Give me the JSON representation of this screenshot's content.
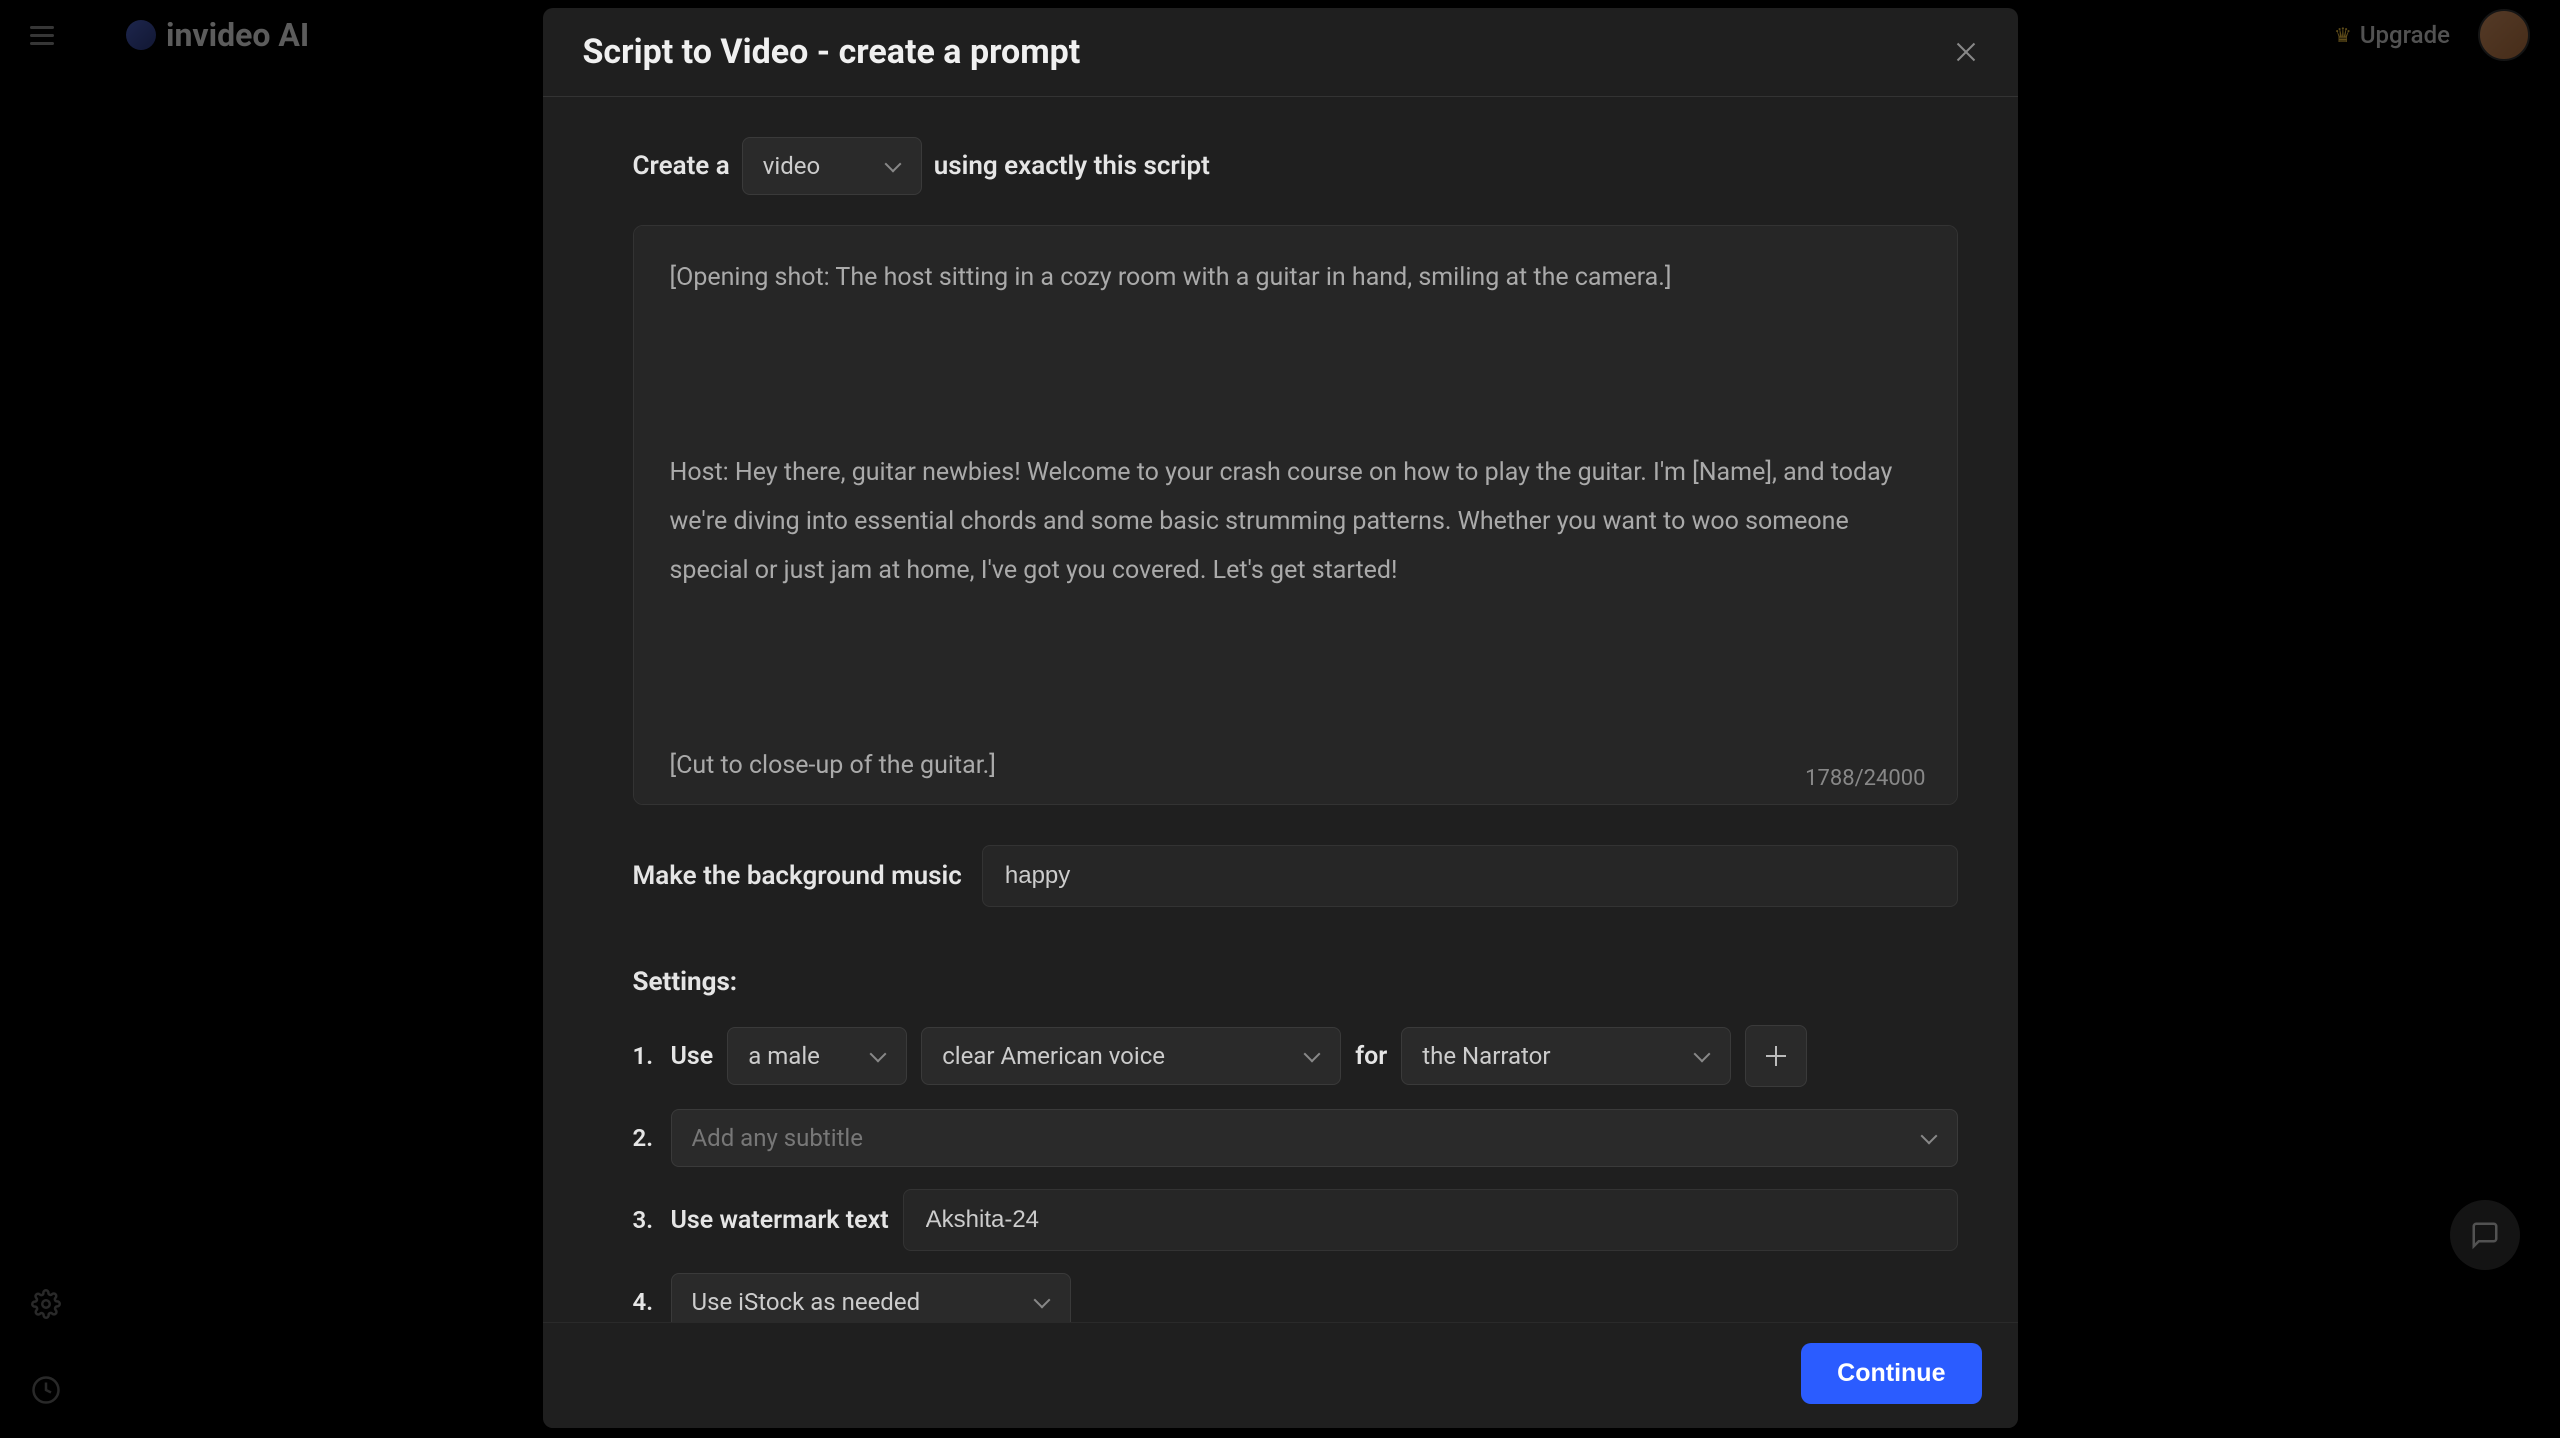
{
  "app": {
    "logo_text": "invideo AI"
  },
  "topbar": {
    "upgrade_label": "Upgrade"
  },
  "modal": {
    "title": "Script to Video - create a prompt",
    "create_a_label": "Create a",
    "video_type": {
      "selected": "video"
    },
    "using_exactly_label": "using exactly this script",
    "script_text": "[Opening shot: The host sitting in a cozy room with a guitar in hand, smiling at the camera.]\n\n\n\nHost: Hey there, guitar newbies! Welcome to your crash course on how to play the guitar. I'm [Name], and today we're diving into essential chords and some basic strumming patterns. Whether you want to woo someone special or just jam at home, I've got you covered. Let's get started!\n\n\n\n[Cut to close-up of the guitar.]",
    "char_count": "1788/24000",
    "music_label": "Make the background music",
    "music_value": "happy",
    "settings_heading": "Settings:",
    "settings": {
      "row1": {
        "number": "1.",
        "use_label": "Use",
        "voice_gender": "a male",
        "voice_accent": "clear American voice",
        "for_label": "for",
        "narrator": "the Narrator"
      },
      "row2": {
        "number": "2.",
        "subtitle_placeholder": "Add any subtitle"
      },
      "row3": {
        "number": "3.",
        "watermark_label": "Use watermark text",
        "watermark_value": "Akshita-24"
      },
      "row4": {
        "number": "4.",
        "istock": "Use iStock as needed"
      }
    },
    "continue_label": "Continue"
  }
}
